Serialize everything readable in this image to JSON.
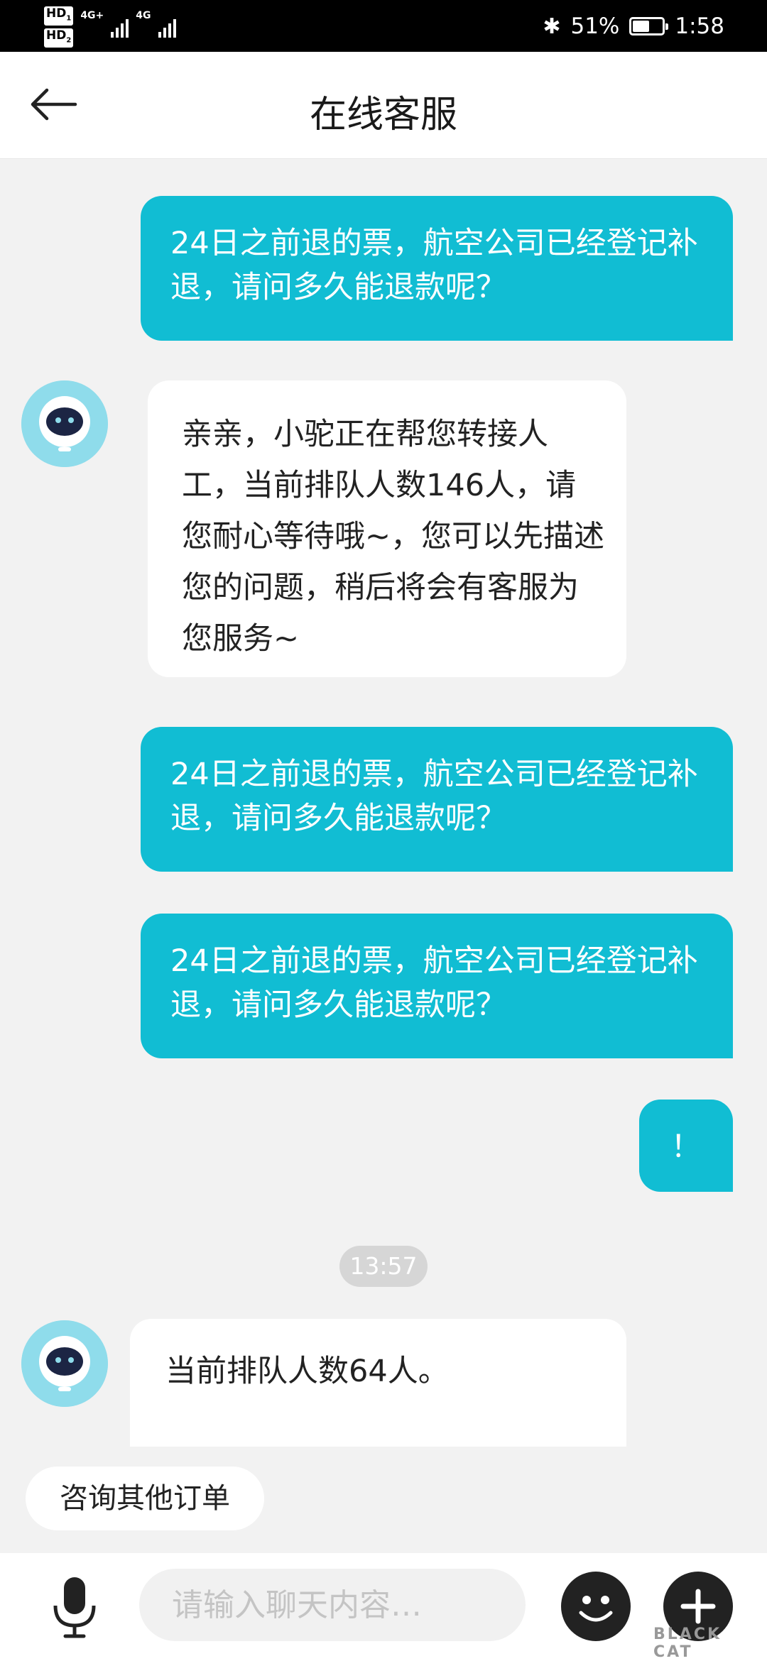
{
  "status_bar": {
    "hd1": "HD",
    "hd1_sub": "1",
    "hd2": "HD",
    "hd2_sub": "2",
    "net1": "4G+",
    "net2": "4G",
    "battery_text": "51%",
    "battery_level": 0.51,
    "time": "1:58",
    "bluetooth_icon": "bluetooth-icon"
  },
  "header": {
    "title": "在线客服",
    "back_icon": "back-arrow-icon"
  },
  "messages": [
    {
      "side": "out",
      "text": "24日之前退的票，航空公司已经登记补退，请问多久能退款呢？"
    },
    {
      "side": "in",
      "text": "亲亲，小驼正在帮您转接人工，当前排队人数146人，请您耐心等待哦~，您可以先描述您的问题，稍后将会有客服为您服务~"
    },
    {
      "side": "out",
      "text": "24日之前退的票，航空公司已经登记补退，请问多久能退款呢？"
    },
    {
      "side": "out",
      "text": "24日之前退的票，航空公司已经登记补退，请问多久能退款呢？"
    },
    {
      "side": "out",
      "text": "！"
    },
    {
      "side": "time",
      "text": "13:57"
    },
    {
      "side": "in",
      "text": "当前排队人数64人。"
    }
  ],
  "quick_reply": "咨询其他订单",
  "input": {
    "placeholder": "请输入聊天内容…",
    "mic_icon": "microphone-icon",
    "emoji_icon": "emoji-icon",
    "plus_icon": "plus-icon"
  },
  "watermark": "BLACK CAT",
  "colors": {
    "outgoing_bubble": "#11bdd3",
    "background": "#f2f2f2"
  }
}
